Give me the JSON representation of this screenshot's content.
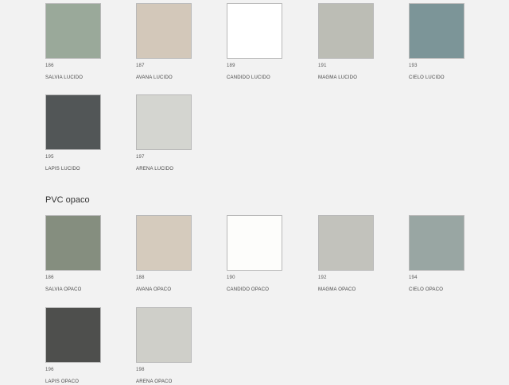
{
  "lucido": {
    "items": [
      {
        "code": "186",
        "name": "SALVIA LUCIDO",
        "color": "#9aa99a"
      },
      {
        "code": "187",
        "name": "AVANA LUCIDO",
        "color": "#d3c8ba"
      },
      {
        "code": "189",
        "name": "CANDIDO LUCIDO",
        "color": "#ffffff"
      },
      {
        "code": "191",
        "name": "MAGMA LUCIDO",
        "color": "#bcbdb5"
      },
      {
        "code": "193",
        "name": "CIELO LUCIDO",
        "color": "#7c9598"
      },
      {
        "code": "195",
        "name": "LAPIS LUCIDO",
        "color": "#525657"
      },
      {
        "code": "197",
        "name": "ARENA LUCIDO",
        "color": "#d4d5d0"
      }
    ]
  },
  "opaco": {
    "title": "PVC opaco",
    "items": [
      {
        "code": "186",
        "name": "SALVIA OPACO",
        "color": "#858e7f"
      },
      {
        "code": "188",
        "name": "AVANA OPACO",
        "color": "#d5cbbd"
      },
      {
        "code": "190",
        "name": "CANDIDO OPACO",
        "color": "#fdfdfb"
      },
      {
        "code": "192",
        "name": "MAGMA OPACO",
        "color": "#c2c2bc"
      },
      {
        "code": "194",
        "name": "CIELO OPACO",
        "color": "#99a6a3"
      },
      {
        "code": "196",
        "name": "LAPIS OPACO",
        "color": "#4e4f4d"
      },
      {
        "code": "198",
        "name": "ARENA OPACO",
        "color": "#cfcfc9"
      }
    ]
  }
}
